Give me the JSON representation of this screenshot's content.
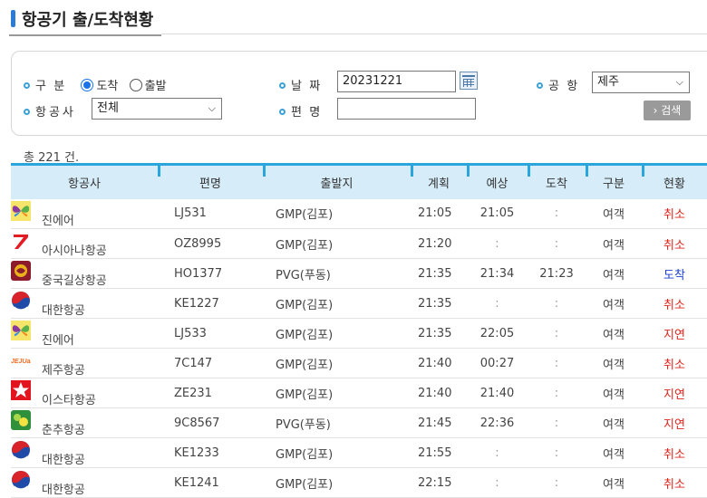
{
  "page": {
    "title": "항공기 출/도착현황"
  },
  "search": {
    "type_label": "구  분",
    "opt_arrival": "도착",
    "opt_departure": "출발",
    "selected": "arrival",
    "airline_label": "항공사",
    "airline_value": "전체",
    "date_label": "날  짜",
    "date_value": "20231221",
    "flight_label": "편  명",
    "flight_value": "",
    "airport_label": "공  항",
    "airport_value": "제주",
    "search_button": "› 검색"
  },
  "result_count": "총 221 건.",
  "table": {
    "headers": [
      "항공사",
      "편명",
      "출발지",
      "계획",
      "예상",
      "도착",
      "구분",
      "현황"
    ],
    "rows": [
      {
        "logo": "jinair-logo",
        "airline": "진에어",
        "flight": "LJ531",
        "origin": "GMP(김포)",
        "planned": "21:05",
        "expected": "21:05",
        "arrived": ":",
        "type": "여객",
        "status": "취소",
        "status_kind": "red"
      },
      {
        "logo": "asiana-logo",
        "airline": "아시아나항공",
        "flight": "OZ8995",
        "origin": "GMP(김포)",
        "planned": "21:20",
        "expected": ":",
        "arrived": ":",
        "type": "여객",
        "status": "취소",
        "status_kind": "red"
      },
      {
        "logo": "juneyao-logo",
        "airline": "중국길상항공",
        "flight": "HO1377",
        "origin": "PVG(푸동)",
        "planned": "21:35",
        "expected": "21:34",
        "arrived": "21:23",
        "type": "여객",
        "status": "도착",
        "status_kind": "blue"
      },
      {
        "logo": "koreanair-logo",
        "airline": "대한항공",
        "flight": "KE1227",
        "origin": "GMP(김포)",
        "planned": "21:35",
        "expected": ":",
        "arrived": ":",
        "type": "여객",
        "status": "취소",
        "status_kind": "red"
      },
      {
        "logo": "jinair-logo",
        "airline": "진에어",
        "flight": "LJ533",
        "origin": "GMP(김포)",
        "planned": "21:35",
        "expected": "22:05",
        "arrived": ":",
        "type": "여객",
        "status": "지연",
        "status_kind": "red"
      },
      {
        "logo": "jejuair-logo",
        "airline": "제주항공",
        "flight": "7C147",
        "origin": "GMP(김포)",
        "planned": "21:40",
        "expected": "00:27",
        "arrived": ":",
        "type": "여객",
        "status": "취소",
        "status_kind": "red"
      },
      {
        "logo": "eastarjet-logo",
        "airline": "이스타항공",
        "flight": "ZE231",
        "origin": "GMP(김포)",
        "planned": "21:40",
        "expected": "21:40",
        "arrived": ":",
        "type": "여객",
        "status": "지연",
        "status_kind": "red"
      },
      {
        "logo": "springair-logo",
        "airline": "춘추항공",
        "flight": "9C8567",
        "origin": "PVG(푸동)",
        "planned": "21:45",
        "expected": "22:36",
        "arrived": ":",
        "type": "여객",
        "status": "지연",
        "status_kind": "red"
      },
      {
        "logo": "koreanair-logo",
        "airline": "대한항공",
        "flight": "KE1233",
        "origin": "GMP(김포)",
        "planned": "21:55",
        "expected": ":",
        "arrived": ":",
        "type": "여객",
        "status": "취소",
        "status_kind": "red"
      },
      {
        "logo": "koreanair-logo",
        "airline": "대한항공",
        "flight": "KE1241",
        "origin": "GMP(김포)",
        "planned": "22:15",
        "expected": ":",
        "arrived": ":",
        "type": "여객",
        "status": "취소",
        "status_kind": "red"
      }
    ]
  },
  "colors": {
    "accent": "#2aa6dd",
    "header_bg": "#d6ecf8",
    "status_red": "#e0241b",
    "status_blue": "#1a3fd0"
  }
}
